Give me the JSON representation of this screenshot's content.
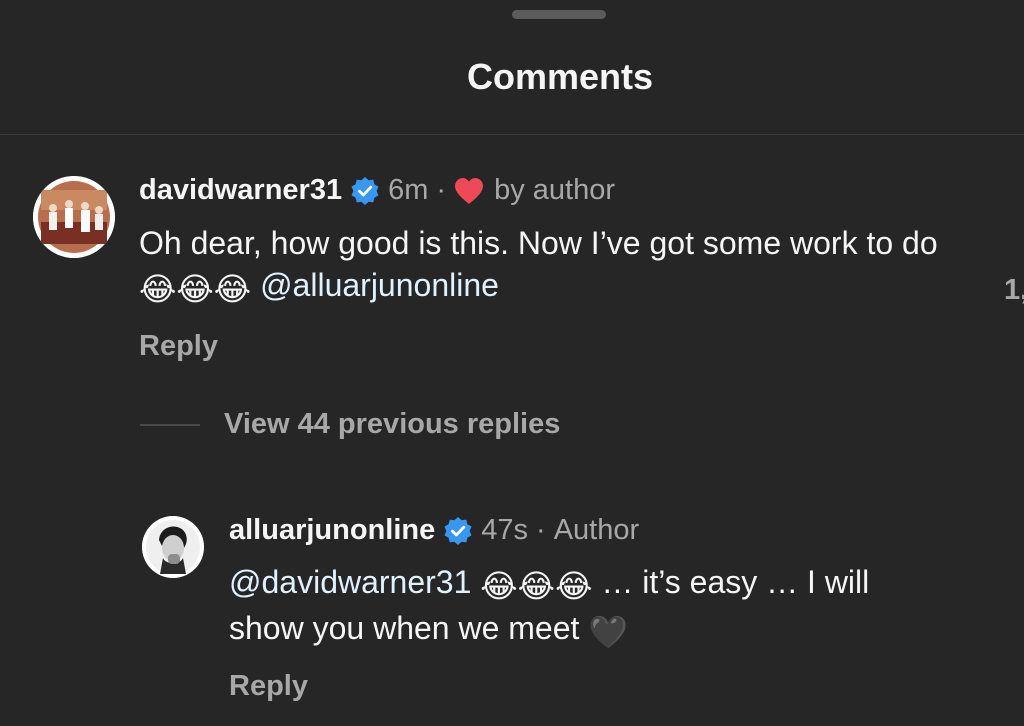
{
  "sheet": {
    "title": "Comments"
  },
  "comments": [
    {
      "username": "davidwarner31",
      "verified": true,
      "time": "6m",
      "separator": "·",
      "liked_by_author": true,
      "liked_label": "by author",
      "text_before": "Oh dear, how good is this. Now I’ve got some work to do",
      "emoji": "😂😂😂",
      "mention": "@alluarjunonline",
      "reply_label": "Reply",
      "like_count_partial": "1,"
    }
  ],
  "thread": {
    "view_replies_label": "View 44 previous replies"
  },
  "replies": [
    {
      "username": "alluarjunonline",
      "verified": true,
      "time": "47s",
      "separator": "·",
      "author_label": "Author",
      "mention": "@davidwarner31",
      "emoji": "😂😂😂",
      "text_after": "… it’s easy … I will show you when we meet",
      "trailing_emoji": "🖤",
      "reply_label": "Reply"
    }
  ],
  "colors": {
    "background": "#262626",
    "primary_text": "#f5f5f5",
    "secondary_text": "#a8a8a8",
    "verified_blue": "#3897f0",
    "heart_red": "#ed4956"
  },
  "icons": {
    "verified": "verified-badge-icon",
    "heart": "heart-icon"
  }
}
